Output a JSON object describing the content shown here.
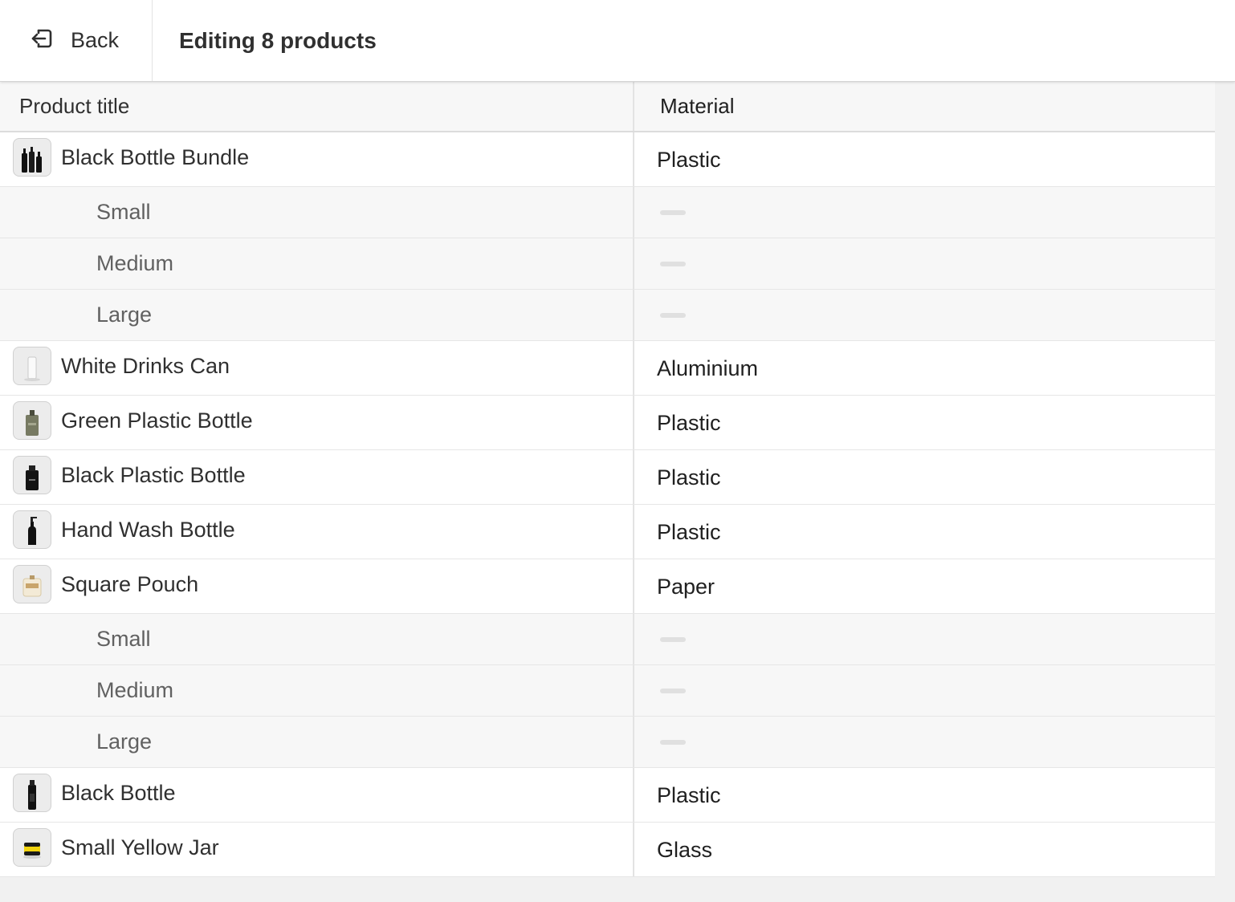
{
  "header": {
    "back_label": "Back",
    "title": "Editing 8 products"
  },
  "table": {
    "columns": [
      "Product title",
      "Material"
    ],
    "rows": [
      {
        "kind": "product",
        "title": "Black Bottle Bundle",
        "material": "Plastic",
        "icon": "black-bottles-bundle-thumbnail"
      },
      {
        "kind": "variant",
        "title": "Small",
        "material": ""
      },
      {
        "kind": "variant",
        "title": "Medium",
        "material": ""
      },
      {
        "kind": "variant",
        "title": "Large",
        "material": ""
      },
      {
        "kind": "product",
        "title": "White Drinks Can",
        "material": "Aluminium",
        "icon": "white-can-thumbnail"
      },
      {
        "kind": "product",
        "title": "Green Plastic Bottle",
        "material": "Plastic",
        "icon": "green-bottle-thumbnail"
      },
      {
        "kind": "product",
        "title": "Black Plastic Bottle",
        "material": "Plastic",
        "icon": "black-bottle-thumbnail"
      },
      {
        "kind": "product",
        "title": "Hand Wash Bottle",
        "material": "Plastic",
        "icon": "hand-wash-bottle-thumbnail"
      },
      {
        "kind": "product",
        "title": "Square Pouch",
        "material": "Paper",
        "icon": "square-pouch-thumbnail"
      },
      {
        "kind": "variant",
        "title": "Small",
        "material": ""
      },
      {
        "kind": "variant",
        "title": "Medium",
        "material": ""
      },
      {
        "kind": "variant",
        "title": "Large",
        "material": ""
      },
      {
        "kind": "product",
        "title": "Black Bottle",
        "material": "Plastic",
        "icon": "tall-black-bottle-thumbnail"
      },
      {
        "kind": "product",
        "title": "Small Yellow Jar",
        "material": "Glass",
        "icon": "yellow-jar-thumbnail"
      }
    ]
  },
  "colors": {
    "background": "#f1f1f1",
    "surface": "#ffffff",
    "variant_row": "#f7f7f7",
    "text": "#303030",
    "muted_text": "#616161"
  }
}
